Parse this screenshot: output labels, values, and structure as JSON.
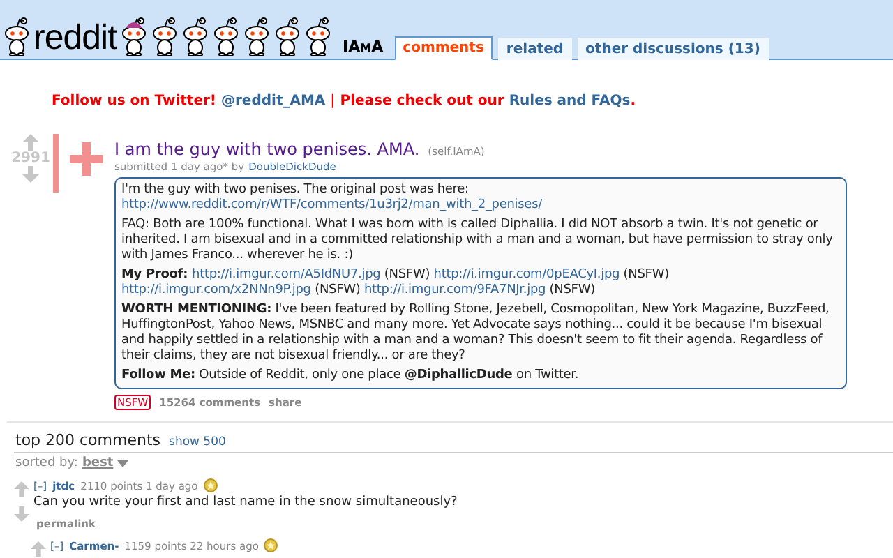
{
  "header": {
    "logo": "reddit",
    "subreddit": "IAmA",
    "tabs": [
      {
        "label": "comments",
        "selected": true
      },
      {
        "label": "related",
        "selected": false
      },
      {
        "label": "other discussions (13)",
        "selected": false
      }
    ]
  },
  "announcement": [
    {
      "kind": "text",
      "text": "Follow us on Twitter! "
    },
    {
      "kind": "link",
      "text": "@reddit_AMA"
    },
    {
      "kind": "text",
      "text": " | Please check out our "
    },
    {
      "kind": "link",
      "text": "Rules and FAQs"
    },
    {
      "kind": "text",
      "text": "."
    }
  ],
  "post": {
    "score": "2991",
    "title": "I am the guy with two penises. AMA.",
    "domain": "(self.IAmA)",
    "tagline": "submitted 1 day ago* by",
    "author": "DoubleDickDude",
    "body": [
      [
        {
          "kind": "text",
          "text": "I'm the guy with two penises. The original post was here: "
        },
        {
          "kind": "link",
          "text": "http://www.reddit.com/r/WTF/comments/1u3rj2/man_with_2_penises/"
        }
      ],
      [
        {
          "kind": "text",
          "text": "FAQ: Both are 100% functional. What I was born with is called Diphallia. I did NOT absorb a twin. It's not genetic or inherited. I am bisexual and in a committed relationship with a man and a woman, but have permission to stray only with James Franco... wherever he is. :)"
        }
      ],
      [
        {
          "kind": "bold",
          "text": "My Proof: "
        },
        {
          "kind": "link",
          "text": "http://i.imgur.com/A5IdNU7.jpg"
        },
        {
          "kind": "text",
          "text": " (NSFW) "
        },
        {
          "kind": "link",
          "text": "http://i.imgur.com/0pEACyI.jpg"
        },
        {
          "kind": "text",
          "text": " (NSFW) "
        },
        {
          "kind": "link",
          "text": "http://i.imgur.com/x2NNn9P.jpg"
        },
        {
          "kind": "text",
          "text": " (NSFW) "
        },
        {
          "kind": "link",
          "text": "http://i.imgur.com/9FA7NJr.jpg"
        },
        {
          "kind": "text",
          "text": " (NSFW)"
        }
      ],
      [
        {
          "kind": "bold",
          "text": "WORTH MENTIONING:"
        },
        {
          "kind": "text",
          "text": " I've been featured by Rolling Stone, Jezebell, Cosmopolitan, New York Magazine, BuzzFeed, HuffingtonPost, Yahoo News, MSNBC and many more. Yet Advocate says nothing... could it be because I'm bisexual and happily settled in a relationship with a man and a woman? This doesn't seem to fit their agenda. Regardless of their claims, they are not bisexual friendly... or are they?"
        }
      ],
      [
        {
          "kind": "bold",
          "text": "Follow Me:"
        },
        {
          "kind": "text",
          "text": " Outside of Reddit, only one place "
        },
        {
          "kind": "bold",
          "text": "@DiphallicDude"
        },
        {
          "kind": "text",
          "text": " on Twitter."
        }
      ]
    ],
    "tag": "NSFW",
    "comments_link": "15264 comments",
    "share": "share"
  },
  "comments_header": {
    "title": "top 200 comments",
    "show": "show 500",
    "sorted_label": "sorted by:",
    "sort": "best"
  },
  "comments": [
    {
      "toggle": "[–]",
      "author": "jtdc",
      "meta": "2110 points 1 day ago",
      "gilded": true,
      "text": "Can you write your first and last name in the snow simultaneously?",
      "permalink": "permalink",
      "children": [
        {
          "toggle": "[–]",
          "author": "Carmen-",
          "meta": "1159 points 22 hours ago",
          "gilded": true
        }
      ]
    }
  ]
}
